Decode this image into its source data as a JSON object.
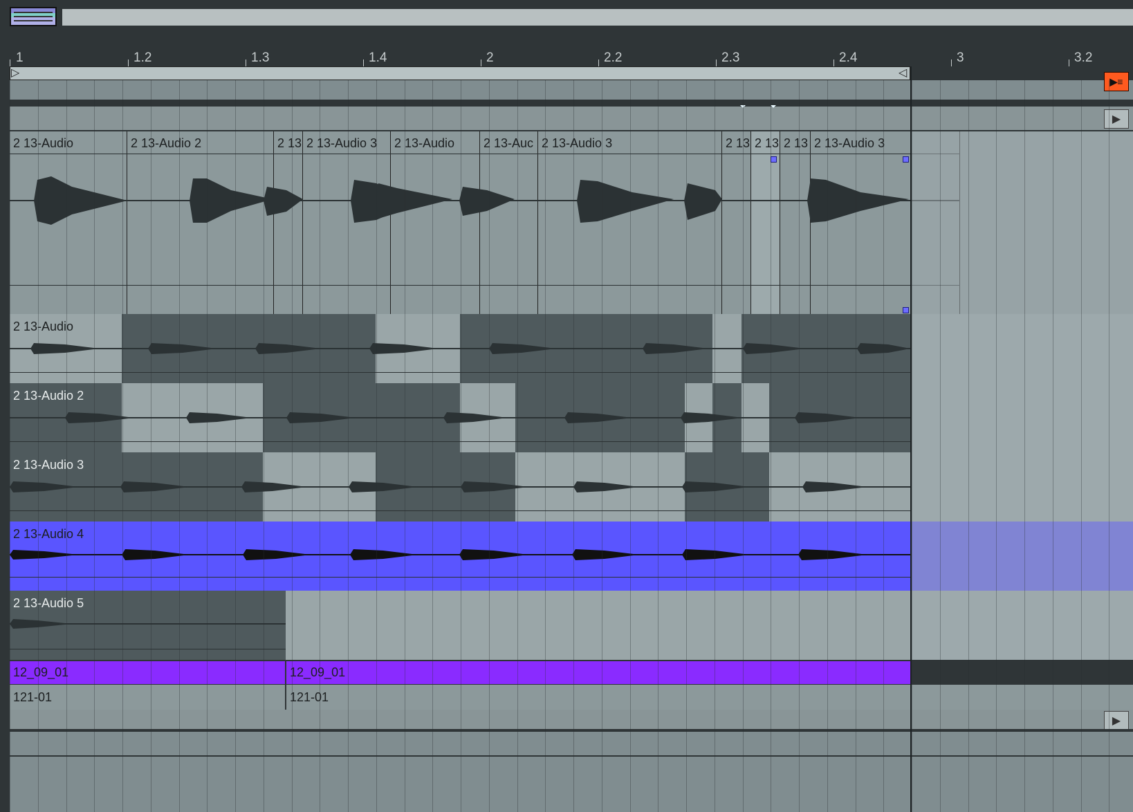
{
  "ruler": {
    "labels": [
      "1",
      "1.2",
      "1.3",
      "1.4",
      "2",
      "2.2",
      "2.3",
      "2.4",
      "3",
      "3.2"
    ]
  },
  "colors": {
    "background": "#2e3436",
    "lane": "#8c999b",
    "selected_clip": "#5a55ff",
    "marker_clip": "#8a2bff",
    "dark_clip": "#4f5a5d",
    "light_clip": "#9aa6a8",
    "launch_button": "#ff5a1f"
  },
  "main_track": {
    "clips": [
      "2 13-Audio",
      "2 13-Audio 2",
      "2 13",
      "2 13-Audio 3",
      "2 13-Audio",
      "2 13-Auc",
      "2 13-Audio 3",
      "2 13",
      "2 13",
      "2 13",
      "2 13-Audio 3"
    ]
  },
  "tracks": [
    {
      "name": "2 13-Audio"
    },
    {
      "name": "2 13-Audio 2"
    },
    {
      "name": "2 13-Audio 3"
    },
    {
      "name": "2 13-Audio 4"
    },
    {
      "name": "2 13-Audio 5"
    }
  ],
  "markers": {
    "row1": [
      "12_09_01",
      "12_09_01"
    ],
    "row2": [
      "121-01",
      "121-01"
    ]
  },
  "icons": {
    "launch": "play-list-icon",
    "play": "play-triangle-icon"
  },
  "glyphs": {
    "launch": "▶≡",
    "play": "▶",
    "loop_start": "▷",
    "loop_end": "◁"
  }
}
